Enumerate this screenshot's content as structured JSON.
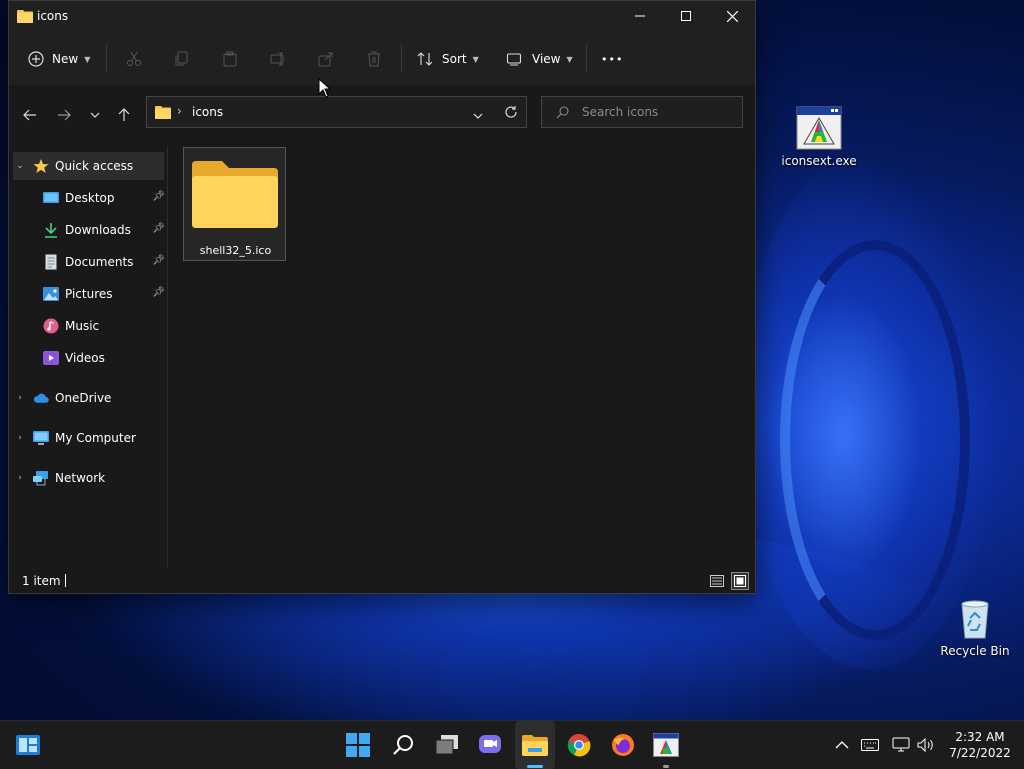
{
  "window": {
    "title": "icons",
    "buttons": {
      "minimize": "—",
      "maximize": "☐",
      "close": "✕"
    }
  },
  "toolbar": {
    "new_label": "New",
    "sort_label": "Sort",
    "view_label": "View",
    "more_label": "•••"
  },
  "navigation": {
    "address_segment": "icons",
    "search_placeholder": "Search icons"
  },
  "sidebar": {
    "quick_access": "Quick access",
    "items": [
      {
        "label": "Desktop",
        "icon": "desktop-icon",
        "pinned": true
      },
      {
        "label": "Downloads",
        "icon": "downloads-icon",
        "pinned": true
      },
      {
        "label": "Documents",
        "icon": "documents-icon",
        "pinned": true
      },
      {
        "label": "Pictures",
        "icon": "pictures-icon",
        "pinned": true
      },
      {
        "label": "Music",
        "icon": "music-icon",
        "pinned": false
      },
      {
        "label": "Videos",
        "icon": "videos-icon",
        "pinned": false
      }
    ],
    "onedrive": "OneDrive",
    "my_computer": "My Computer",
    "network": "Network"
  },
  "content": {
    "files": [
      {
        "name": "shell32_5.ico",
        "icon": "folder-icon"
      }
    ]
  },
  "status": {
    "item_count": "1 item"
  },
  "desktop": {
    "icons": [
      {
        "label": "iconsext.exe",
        "icon": "iconsext-app-icon"
      },
      {
        "label": "Recycle Bin",
        "icon": "recycle-bin-icon"
      }
    ]
  },
  "taskbar": {
    "time": "2:32 AM",
    "date": "7/22/2022"
  },
  "colors": {
    "folder_yellow": "#f6c94a",
    "accent_blue": "#4cc2ff",
    "window_bg": "#191919"
  }
}
